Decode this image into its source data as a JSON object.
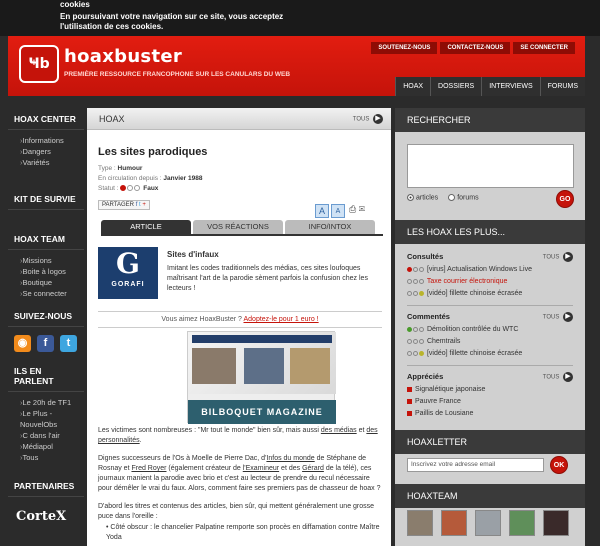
{
  "cookie": {
    "title": "cookies",
    "text": "En poursuivant votre navigation sur ce site, vous acceptez l'utilisation de ces cookies."
  },
  "header": {
    "logo_mark": "Ҹb",
    "title": "hoaxbuster",
    "subtitle": "PREMIÈRE RESSOURCE FRANCOPHONE SUR LES CANULARS DU WEB",
    "toplinks": [
      "SOUTENEZ-NOUS",
      "CONTACTEZ-NOUS",
      "SE CONNECTER"
    ],
    "nav": [
      "HOAX",
      "DOSSIERS",
      "INTERVIEWS",
      "FORUMS"
    ]
  },
  "left": {
    "hoax_center": {
      "title": "HOAX CENTER",
      "items": [
        "Informations",
        "Dangers",
        "Variétés"
      ]
    },
    "kit": {
      "title": "KIT DE SURVIE"
    },
    "team": {
      "title": "HOAX TEAM",
      "items": [
        "Missions",
        "Boite à logos",
        "Boutique",
        "Se connecter"
      ]
    },
    "suivez": {
      "title": "SUIVEZ-NOUS"
    },
    "parlent": {
      "title": "ILS EN PARLENT",
      "items": [
        "Le 20h de TF1",
        "Le Plus - NouvelObs",
        "C dans l'air",
        "Médiapol",
        "Tous"
      ]
    },
    "partenaires": {
      "title": "PARTENAIRES",
      "logo": "CorteX"
    }
  },
  "center": {
    "section": "HOAX",
    "tous": "TOUS",
    "title": "Les sites parodiques",
    "meta": {
      "type_label": "Type :",
      "type_value": "Humour",
      "date_label": "En circulation depuis :",
      "date_value": "Janvier 1988",
      "status_label": "Statut :",
      "status_value": "Faux"
    },
    "partager": "PARTAGER",
    "font_a": "A",
    "tabs": [
      "ARTICLE",
      "VOS RÉACTIONS",
      "INFO/INTOX"
    ],
    "gorafi": {
      "letter": "G",
      "name": "GORAFI"
    },
    "sites_title": "Sites d'infaux",
    "sites_desc": "Imitant les codes traditionnels des médias, ces sites loufoques maîtrisant l'art de la parodie sèment parfois la confusion chez les lecteurs !",
    "promo_text": "Vous aimez HoaxBuster ? ",
    "promo_link": "Adoptez-le pour 1 euro !",
    "shot_banner": "BILBOQUET MAGAZINE",
    "p1a": "Les victimes sont nombreuses : \"Mr tout le monde\" bien sûr, mais aussi ",
    "p1b": "des médias",
    "p1c": " et ",
    "p1d": "des personnalités",
    "p1e": ".",
    "p2a": "Dignes successeurs de l'Os à Moelle de Pierre Dac, d'",
    "p2b": "Infos du monde",
    "p2c": " de Stéphane de Rosnay et ",
    "p2d": "Fred Royer",
    "p2e": " (également créateur de ",
    "p2f": "l'Examineur",
    "p2g": " et des ",
    "p2h": "Gérard",
    "p2i": " de la télé), ces journaux manient la parodie avec brio et c'est au lecteur de prendre du recul nécessaire pour démêler le vrai du faux. Alors, comment faire ses premiers pas de chasseur de hoax ?",
    "p3": "D'abord les titres et contenus des articles, bien sûr, qui mettent généralement une grosse puce dans l'oreille :",
    "bullet": "Côté obscur : le chancelier Palpatine remporte son procès en diffamation contre Maître Yoda"
  },
  "right": {
    "recherche": "RECHERCHER",
    "radio_articles": "articles",
    "radio_forums": "forums",
    "go": "GO",
    "plus_title": "LES HOAX LES PLUS...",
    "tous": "TOUS",
    "consultes": {
      "title": "Consultés",
      "items": [
        "[virus] Actualisation Windows Live",
        "Taxe courrier électronique",
        "[vidéo] fillette chinoise écrasée"
      ]
    },
    "commentes": {
      "title": "Commentés",
      "items": [
        "Démolition contrôlée du WTC",
        "Chemtrails",
        "[vidéo] fillette chinoise écrasée"
      ]
    },
    "apprecies": {
      "title": "Appréciés",
      "items": [
        "Signalétique japonaise",
        "Pauvre France",
        "Paillis de Lousiane"
      ]
    },
    "hoaxletter": "HOAXLETTER",
    "news_placeholder": "Inscrivez votre adresse email",
    "ok": "OK",
    "hoaxteam": "HOAXTEAM"
  },
  "colors": {
    "brand_red": "#d8160b",
    "dark": "#2b2b2b",
    "sidebar": "#d0d0d0"
  }
}
